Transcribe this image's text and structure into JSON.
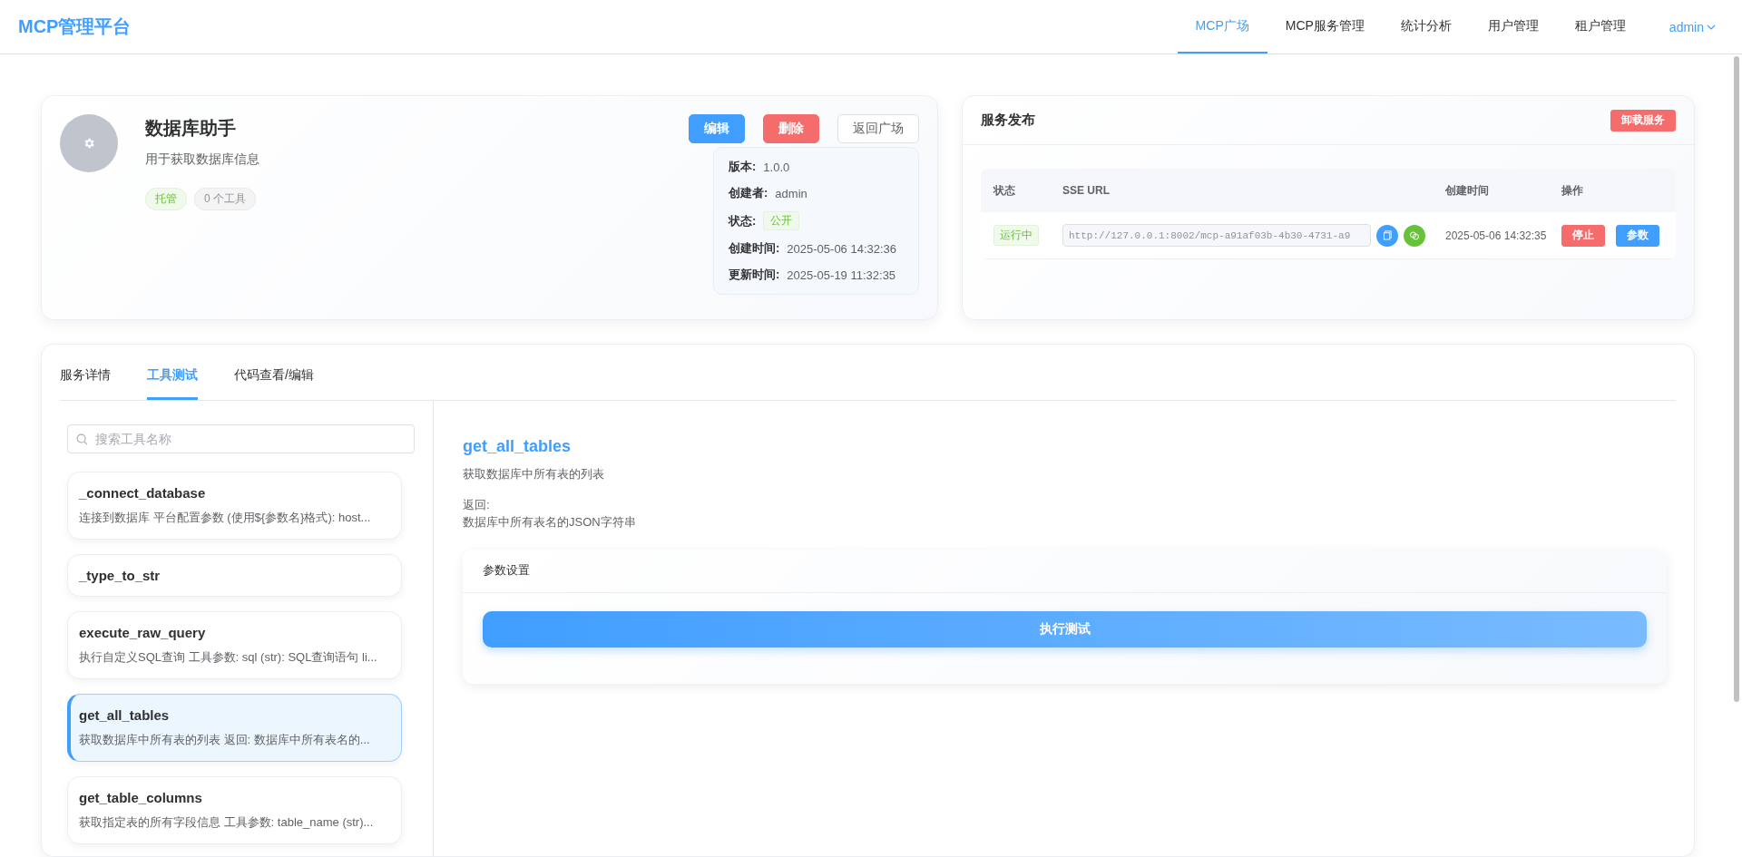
{
  "header": {
    "logo": "MCP管理平台",
    "nav": [
      {
        "label": "MCP广场",
        "selected": true
      },
      {
        "label": "MCP服务管理",
        "selected": false
      },
      {
        "label": "统计分析",
        "selected": false
      },
      {
        "label": "用户管理",
        "selected": false
      },
      {
        "label": "租户管理",
        "selected": false
      }
    ],
    "user": "admin"
  },
  "service": {
    "name": "数据库助手",
    "description": "用于获取数据库信息",
    "tags": [
      {
        "label": "托管",
        "kind": "success"
      },
      {
        "label": "0 个工具",
        "kind": "neutral"
      }
    ],
    "actions": [
      {
        "label": "编辑",
        "kind": "primary"
      },
      {
        "label": "删除",
        "kind": "danger"
      },
      {
        "label": "返回广场",
        "kind": "plain"
      }
    ],
    "meta": [
      {
        "label": "版本:",
        "value": "1.0.0",
        "kind": "text"
      },
      {
        "label": "创建者:",
        "value": "admin",
        "kind": "text"
      },
      {
        "label": "状态:",
        "value": "公开",
        "kind": "tag"
      },
      {
        "label": "创建时间:",
        "value": "2025-05-06 14:32:36",
        "kind": "text"
      },
      {
        "label": "更新时间:",
        "value": "2025-05-19 11:32:35",
        "kind": "text"
      }
    ]
  },
  "publish": {
    "title": "服务发布",
    "unload_button": "卸载服务",
    "columns": [
      "状态",
      "SSE URL",
      "创建时间",
      "操作"
    ],
    "rows": [
      {
        "status": "运行中",
        "url": "http://127.0.0.1:8002/mcp-a91af03b-4b30-4731-a9",
        "created": "2025-05-06 14:32:35",
        "actions": [
          {
            "label": "停止",
            "kind": "danger"
          },
          {
            "label": "参数",
            "kind": "primary"
          }
        ]
      }
    ]
  },
  "detail_tabs": [
    {
      "label": "服务详情",
      "selected": false
    },
    {
      "label": "工具测试",
      "selected": true
    },
    {
      "label": "代码查看/编辑",
      "selected": false
    }
  ],
  "search": {
    "placeholder": "搜索工具名称"
  },
  "tools": [
    {
      "name": "_connect_database",
      "description": "连接到数据库 平台配置参数 (使用${参数名}格式): host...",
      "selected": false
    },
    {
      "name": "_type_to_str",
      "selected": false
    },
    {
      "name": "execute_raw_query",
      "description": "执行自定义SQL查询 工具参数: sql (str): SQL查询语句 li...",
      "selected": false
    },
    {
      "name": "get_all_tables",
      "description": "获取数据库中所有表的列表 返回: 数据库中所有表名的...",
      "selected": true
    },
    {
      "name": "get_table_columns",
      "description": "获取指定表的所有字段信息 工具参数: table_name (str)...",
      "selected": false
    }
  ],
  "tool_detail": {
    "name": "get_all_tables",
    "description": "获取数据库中所有表的列表",
    "returns_label": "返回:",
    "returns": "数据库中所有表名的JSON字符串",
    "params_title": "参数设置",
    "run_button": "执行测试"
  }
}
